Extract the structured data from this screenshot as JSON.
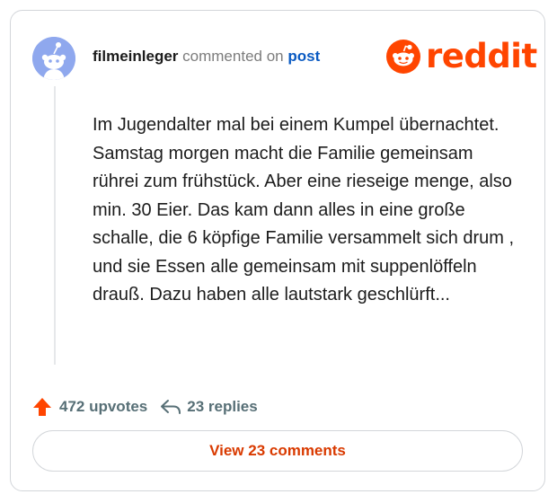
{
  "comment": {
    "username": "filmeinleger",
    "action_text": "commented on",
    "post_link": "post",
    "body": "Im Jugendalter mal bei einem Kumpel übernachtet. Samstag morgen macht die Familie gemeinsam rührei zum frühstück. Aber eine rieseige menge, also min. 30 Eier. Das kam dann alles in eine große schalle, die 6 köpfige Familie versammelt sich drum , und sie Essen alle gemeinsam mit suppenlöffeln drauß. Dazu haben alle lautstark geschlürft..."
  },
  "brand": {
    "wordmark": "reddit",
    "color": "#ff4500"
  },
  "stats": {
    "upvotes": "472 upvotes",
    "replies": "23 replies",
    "upvote_color": "#ff4500"
  },
  "view_button": {
    "label": "View 23 comments",
    "color": "#d93a00"
  },
  "icons": {
    "avatar": "snoo-avatar-icon",
    "logo": "reddit-snoo-icon",
    "upvote": "upvote-arrow-icon",
    "reply": "reply-arrow-icon"
  }
}
